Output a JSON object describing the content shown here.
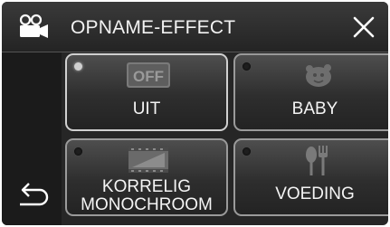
{
  "header": {
    "title": "OPNAME-EFFECT",
    "mode_icon": "video-camera-icon",
    "close_icon": "close-icon"
  },
  "options": [
    {
      "label_lines": [
        "UIT"
      ],
      "icon": "off-icon",
      "selected": true
    },
    {
      "label_lines": [
        "BABY"
      ],
      "icon": "baby-icon",
      "selected": false
    },
    {
      "label_lines": [
        "KORRELIG",
        "MONOCHROOM"
      ],
      "icon": "film-grain-icon",
      "selected": false
    },
    {
      "label_lines": [
        "VOEDING"
      ],
      "icon": "fork-spoon-icon",
      "selected": false
    }
  ],
  "footer": {
    "back_icon": "return-arrow-icon"
  },
  "colors": {
    "background": "#262626",
    "tile_border": "#9a9a9a",
    "text": "#f4f4f4"
  }
}
